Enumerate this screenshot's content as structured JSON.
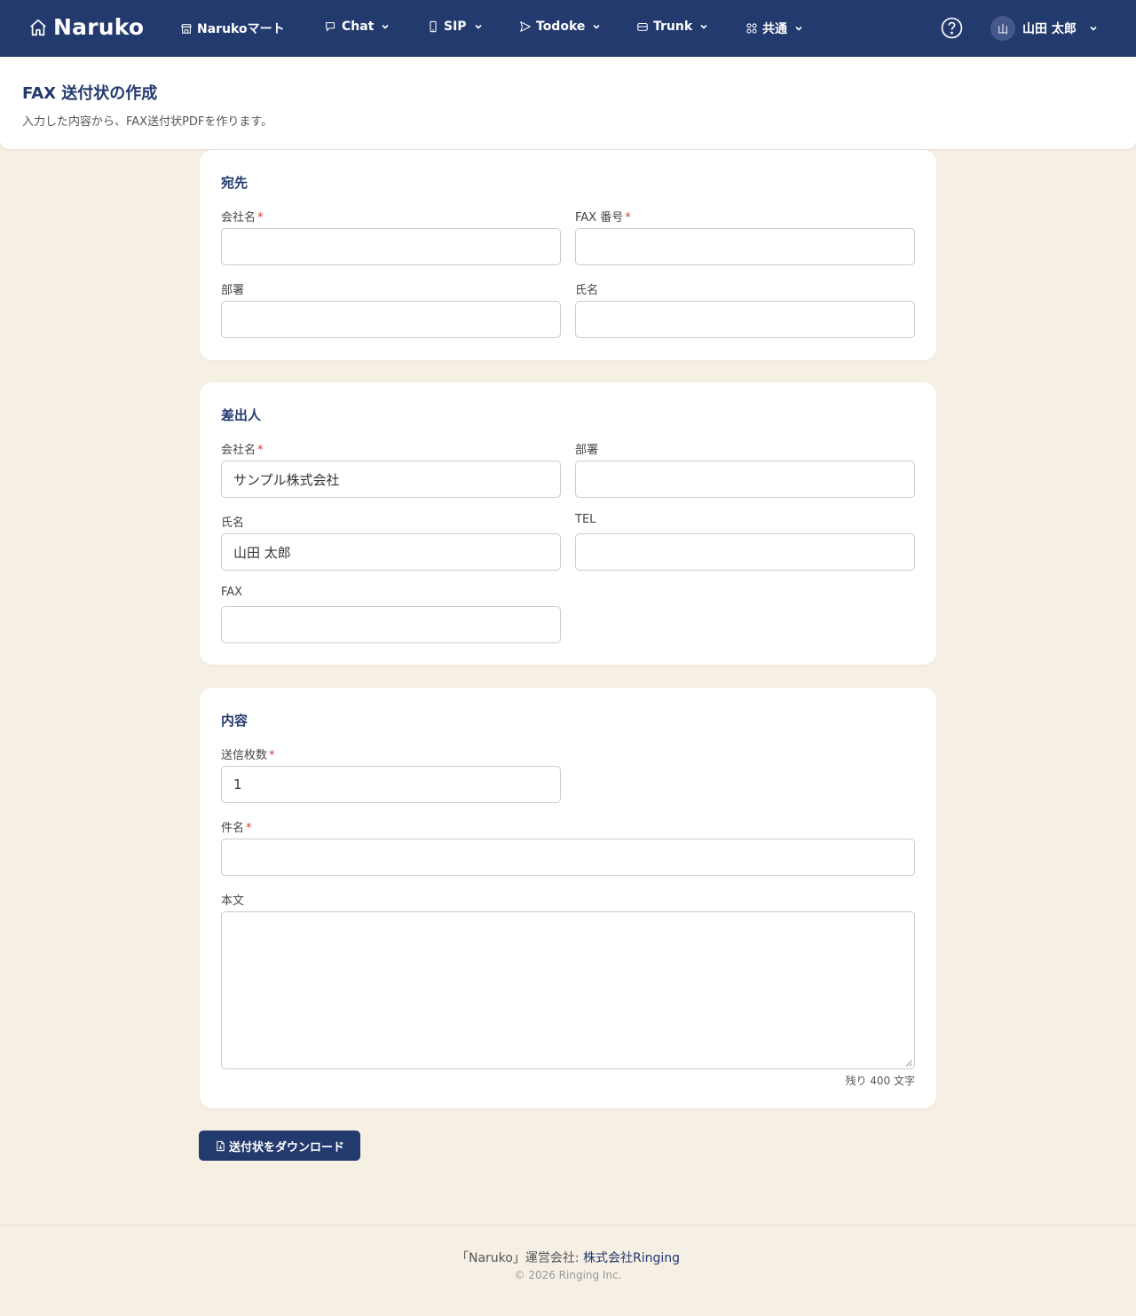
{
  "nav": {
    "brand": "Naruko",
    "items": [
      {
        "label": "Narukoマート",
        "icon": "store-icon",
        "has_menu": false
      },
      {
        "label": "Chat",
        "icon": "chat-icon",
        "has_menu": true
      },
      {
        "label": "SIP",
        "icon": "phone-icon",
        "has_menu": true
      },
      {
        "label": "Todoke",
        "icon": "send-icon",
        "has_menu": true
      },
      {
        "label": "Trunk",
        "icon": "trunk-icon",
        "has_menu": true
      },
      {
        "label": "共通",
        "icon": "grid-icon",
        "has_menu": true
      }
    ],
    "user_initial": "山",
    "user_name": "山田 太郎"
  },
  "page": {
    "title": "FAX 送付状の作成",
    "subtitle": "入力した内容から、FAX送付状PDFを作ります。"
  },
  "recipient": {
    "title": "宛先",
    "company_label": "会社名",
    "company_value": "",
    "fax_label": "FAX 番号",
    "fax_value": "",
    "dept_label": "部署",
    "dept_value": "",
    "name_label": "氏名",
    "name_value": ""
  },
  "sender": {
    "title": "差出人",
    "company_label": "会社名",
    "company_value": "サンプル株式会社",
    "dept_label": "部署",
    "dept_value": "",
    "name_label": "氏名",
    "name_value": "山田 太郎",
    "tel_label": "TEL",
    "tel_value": "",
    "fax_label": "FAX",
    "fax_value": ""
  },
  "content": {
    "title": "内容",
    "pages_label": "送信枚数",
    "pages_value": "1",
    "subject_label": "件名",
    "subject_value": "",
    "body_label": "本文",
    "body_value": "",
    "remaining": "残り 400 文字"
  },
  "required_mark": "*",
  "download_label": "送付状をダウンロード",
  "footer": {
    "prefix": "「Naruko」運営会社: ",
    "company_link": "株式会社Ringing",
    "copyright": "© 2026 Ringing Inc."
  },
  "colors": {
    "brand": "#233a6e",
    "background": "#f6efe4",
    "required": "#d23b3b"
  }
}
